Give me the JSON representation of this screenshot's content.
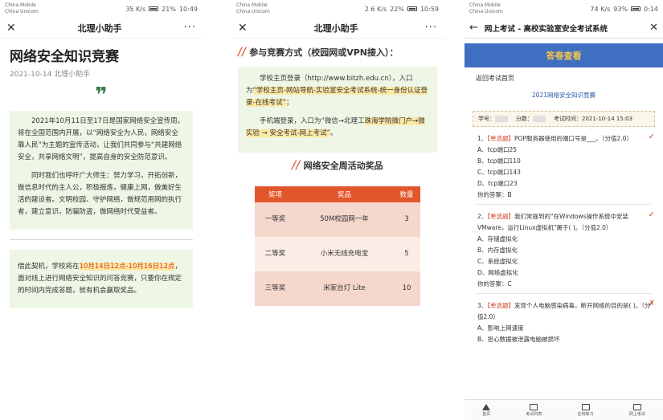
{
  "phone1": {
    "status": {
      "carrier1": "China Mobile",
      "carrier2": "China Unicom",
      "speed": "35 K/s",
      "battery": "21%",
      "time": "10:49"
    },
    "nav_title": "北理小助手",
    "title": "网络安全知识竞赛",
    "meta": "2021-10-14  北理小助手",
    "quote": "❞",
    "para1": "2021年10月11日至17日是国家网络安全宣传周，将在全国范围内开展，以“网络安全为人民，网络安全靠人民”为主题的宣传活动，让我们共同参与“共建网络安全，共享网络文明”，提高自身的安全防范意识。",
    "para2": "同时我们也呼吁广大师生：努力学习，开拓创新，做信息时代的主人公，积极报炼，健康上网，做美好生活的建设者。文明校园、守护网络，做规范用网的执行者，建立意识，防骗防盗，做网络时代受益者。",
    "para3_a": "借此契机，学校将在",
    "para3_hl": "10月14日12点-10月16日12点",
    "para3_b": "，面对线上进行网络安全知识的问答竞赛，只要你在规定的时间内完成答题，就有机会赢取奖品。"
  },
  "phone2": {
    "status": {
      "carrier1": "China Mobile",
      "carrier2": "China Unicom",
      "speed": "2.6 K/s",
      "battery": "22%",
      "time": "10:59"
    },
    "nav_title": "北理小助手",
    "section1": "参与竞赛方式（校园网或VPN接入）：",
    "para1_a": "学校主页登录（http://www.bitzh.edu.cn），入口为",
    "para1_hl": "“学校主页-网站导航-实验室安全考试系统-统一身份认证登录-在线考试”",
    "para1_b": "；",
    "para2_a": "手机端登录，入口为“微信→北理工",
    "para2_hl": "珠海学院微门户→微实验 → 安全考试-网上考试”",
    "para2_b": "。",
    "section2": "网络安全周活动奖品",
    "table": {
      "headers": [
        "奖项",
        "奖品",
        "数量"
      ],
      "rows": [
        [
          "一等奖",
          "50M校园网一年",
          "3"
        ],
        [
          "二等奖",
          "小米无线充电宝",
          "5"
        ],
        [
          "三等奖",
          "米家台灯 Lite",
          "10"
        ]
      ]
    }
  },
  "phone3": {
    "status": {
      "carrier1": "China Mobile",
      "carrier2": "China Unicom",
      "speed": "74 K/s",
      "battery": "93%",
      "time": "0:14"
    },
    "nav_title": "网上考试 - 高校实验室安全考试系统",
    "submit": "答卷查看",
    "back_home": "返回考试首页",
    "exam_title": "2021网络安全知识竞赛",
    "info": {
      "student_label": "学号：",
      "score_label": "分数：",
      "time": "考试时间：2021-10-14 15:03"
    },
    "questions": [
      {
        "tag": "【单选题】",
        "num": "1、",
        "text": "POP服务器使用的端口号是___。（分值2.0）",
        "options": [
          "A、tcp端口25",
          "B、tcp端口110",
          "C、tcp端口143",
          "D、tcp端口23"
        ],
        "answer": "你的答案：B",
        "mark": "✓"
      },
      {
        "tag": "【单选题】",
        "num": "2、",
        "text": "我们常提到的\"在Windows操作系统中安装VMware，运行Linux虚拟机\"属于( )。（分值2.0）",
        "options": [
          "A、存储虚拟化",
          "B、内存虚拟化",
          "C、系统虚拟化",
          "D、网络虚拟化"
        ],
        "answer": "你的答案：C",
        "mark": "✓"
      },
      {
        "tag": "【单选题】",
        "num": "3、",
        "text": "发现个人电脑感染病毒，断开网络的目的是( )。（分值2.0）",
        "options": [
          "A、影响上网速度",
          "B、担心数据被泄露电脑被损坏"
        ],
        "answer": "",
        "mark": "✗"
      }
    ],
    "tabs": [
      "首页",
      "考试列表",
      "在线练习",
      "网上考试"
    ]
  }
}
